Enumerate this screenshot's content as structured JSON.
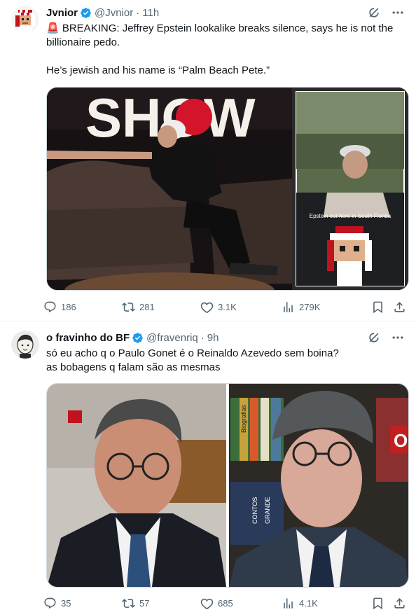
{
  "tweets": [
    {
      "author": "Jvnior",
      "handle": "@Jvnior",
      "time": "11h",
      "verified": true,
      "text": "🚨 BREAKING: Jeffrey Epstein lookalike breaks silence, says he is not the billionaire pedo.\n\nHe’s jewish and his name is “Palm Beach Pete.”",
      "media": {
        "banner": "SHOW",
        "inset_caption": "Epstein out here in South Florida"
      },
      "stats": {
        "replies": "186",
        "reposts": "281",
        "likes": "3.1K",
        "views": "279K"
      }
    },
    {
      "author": "o fravinho do BF",
      "handle": "@fravenriq",
      "time": "9h",
      "verified": true,
      "text": "só eu acho q o Paulo Gonet é o Reinaldo Azevedo sem boina?\nas bobagens q falam são as mesmas",
      "media": {
        "books": [
          "CONTOS",
          "Biografias",
          "GRANDE",
          "O"
        ]
      },
      "stats": {
        "replies": "35",
        "reposts": "57",
        "likes": "685",
        "views": "4.1K"
      }
    }
  ],
  "colors": {
    "text": "#0f1419",
    "muted": "#536471",
    "verified": "#1d9bf0",
    "border": "#cfd9de"
  }
}
